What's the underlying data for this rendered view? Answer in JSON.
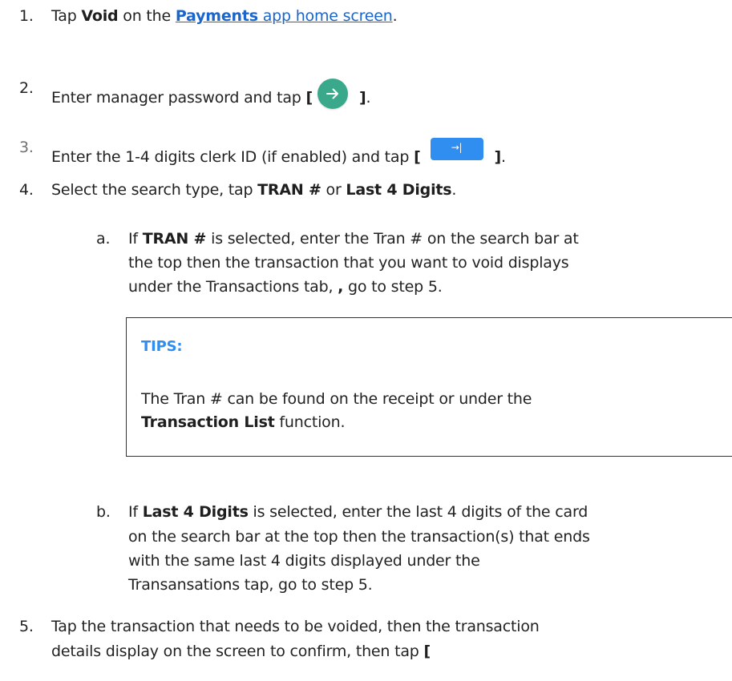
{
  "steps": {
    "s1": {
      "num": "1.",
      "t1": "Tap ",
      "void": "Void",
      "t2": " on the ",
      "payments": "Payments",
      "app_home": " app home screen",
      "end": "."
    },
    "s2": {
      "num": "2.",
      "t1": "Enter manager password and tap ",
      "open": "[",
      "close": "]",
      "end": "."
    },
    "s3": {
      "num": "3.",
      "t1": "Enter the 1-4 digits clerk ID (if enabled) and tap ",
      "open": "[",
      "btn_glyph": "→|",
      "close": "]",
      "end": "."
    },
    "s4": {
      "num": "4.",
      "t1": "Select the search type,  tap ",
      "tran": "TRAN  #",
      "or": " or ",
      "last4": "Last 4 Digits",
      "end": "."
    },
    "s4a": {
      "num": "a.",
      "t1": "If ",
      "tran": "TRAN #",
      "line1": " is selected, enter the Tran # on the search bar at",
      "line2": "the top then the transaction that you want to void displays",
      "line3a": "under the Transactions tab, ",
      "comma": ",",
      "line3b": " go to step 5."
    },
    "tips": {
      "title": "TIPS:",
      "line1": "The Tran # can be found on the receipt or under the",
      "bold": "Transaction List",
      "line2": " function."
    },
    "s4b": {
      "num": "b.",
      "t1": "If ",
      "last4": "Last 4 Digits",
      "line1": " is selected, enter the last 4 digits of the card",
      "line2": "on the search bar at the top then the transaction(s) that ends",
      "line3": "with the same last 4 digits displayed under the",
      "line4": "Transansations tap, go to step 5."
    },
    "s5": {
      "num": "5.",
      "line1": "Tap the transaction that needs to be voided, then the transaction",
      "line2": "details display on the screen to confirm, then tap ",
      "open": "["
    }
  },
  "colors": {
    "link": "#1a66cc",
    "tips_title": "#2f8ef0",
    "circle_button": "#3aa98b",
    "rect_button": "#2f8ef0"
  },
  "icons": {
    "circle_button": "arrow-right-icon",
    "rect_button": "arrow-to-right-bar-icon"
  }
}
